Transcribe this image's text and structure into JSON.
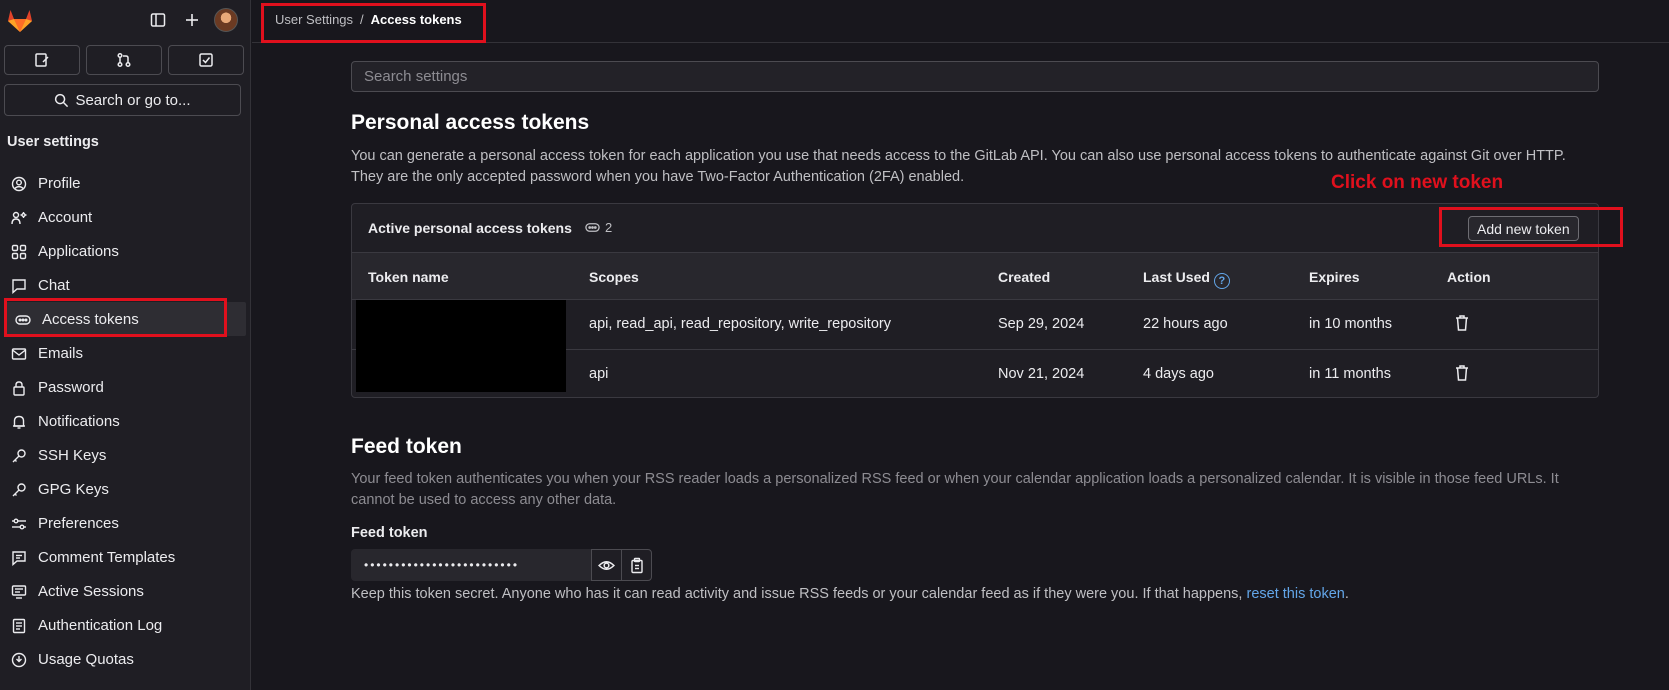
{
  "sidebar": {
    "title": "User settings",
    "search_label": "Search or go to...",
    "items": [
      {
        "label": "Profile",
        "icon": "profile-icon"
      },
      {
        "label": "Account",
        "icon": "account-icon"
      },
      {
        "label": "Applications",
        "icon": "applications-icon"
      },
      {
        "label": "Chat",
        "icon": "chat-icon"
      },
      {
        "label": "Access tokens",
        "icon": "token-icon",
        "active": true
      },
      {
        "label": "Emails",
        "icon": "mail-icon"
      },
      {
        "label": "Password",
        "icon": "lock-icon"
      },
      {
        "label": "Notifications",
        "icon": "bell-icon"
      },
      {
        "label": "SSH Keys",
        "icon": "key-icon"
      },
      {
        "label": "GPG Keys",
        "icon": "key-icon"
      },
      {
        "label": "Preferences",
        "icon": "preferences-icon"
      },
      {
        "label": "Comment Templates",
        "icon": "comment-icon"
      },
      {
        "label": "Active Sessions",
        "icon": "monitor-icon"
      },
      {
        "label": "Authentication Log",
        "icon": "log-icon"
      },
      {
        "label": "Usage Quotas",
        "icon": "quota-icon"
      }
    ]
  },
  "breadcrumb": {
    "parent": "User Settings",
    "separator": "/",
    "current": "Access tokens"
  },
  "search": {
    "placeholder": "Search settings"
  },
  "pat": {
    "title": "Personal access tokens",
    "description": "You can generate a personal access token for each application you use that needs access to the GitLab API. You can also use personal access tokens to authenticate against Git over HTTP. They are the only accepted password when you have Two-Factor Authentication (2FA) enabled.",
    "card_title": "Active personal access tokens",
    "count": "2",
    "add_button": "Add new token",
    "columns": [
      "Token name",
      "Scopes",
      "Created",
      "Last Used",
      "Expires",
      "Action"
    ],
    "rows": [
      {
        "scopes": "api, read_api, read_repository, write_repository",
        "created": "Sep 29, 2024",
        "last_used": "22 hours ago",
        "expires": "in 10 months"
      },
      {
        "scopes": "api",
        "created": "Nov 21, 2024",
        "last_used": "4 days ago",
        "expires": "in 11 months"
      }
    ]
  },
  "feed": {
    "title": "Feed token",
    "description": "Your feed token authenticates you when your RSS reader loads a personalized RSS feed or when your calendar application loads a personalized calendar. It is visible in those feed URLs. It cannot be used to access any other data.",
    "label": "Feed token",
    "masked_value": "•••••••••••••••••••••••••",
    "note_prefix": "Keep this token secret. Anyone who has it can read activity and issue RSS feeds or your calendar feed as if they were you. If that happens,",
    "note_link": "reset this token",
    "note_suffix": "."
  },
  "annotation": {
    "text": "Click on new token",
    "color": "#e0101d"
  },
  "colors": {
    "accent": "#7b58cf",
    "link": "#63a6e9",
    "background": "#18171d"
  }
}
